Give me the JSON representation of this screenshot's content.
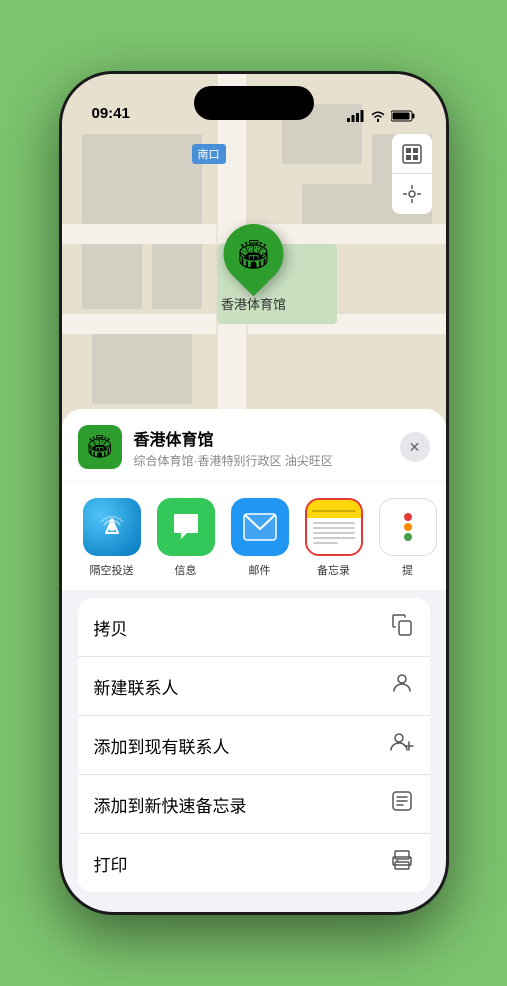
{
  "phone": {
    "status_bar": {
      "time": "09:41",
      "signal_icon": "signal",
      "wifi_icon": "wifi",
      "battery_icon": "battery"
    }
  },
  "map": {
    "label": "南口",
    "stadium_name": "香港体育馆",
    "pin_emoji": "🏟"
  },
  "location_header": {
    "name": "香港体育馆",
    "subtitle": "综合体育馆·香港特别行政区 油尖旺区",
    "close_label": "✕"
  },
  "apps": [
    {
      "id": "airdrop",
      "label": "隔空投送",
      "emoji": "📡"
    },
    {
      "id": "messages",
      "label": "信息",
      "emoji": "💬"
    },
    {
      "id": "mail",
      "label": "邮件",
      "emoji": "✉️"
    },
    {
      "id": "notes",
      "label": "备忘录",
      "highlighted": true
    },
    {
      "id": "more",
      "label": "提"
    }
  ],
  "actions": [
    {
      "label": "拷贝",
      "icon": "copy"
    },
    {
      "label": "新建联系人",
      "icon": "person"
    },
    {
      "label": "添加到现有联系人",
      "icon": "person-add"
    },
    {
      "label": "添加到新快速备忘录",
      "icon": "note"
    },
    {
      "label": "打印",
      "icon": "print"
    }
  ]
}
